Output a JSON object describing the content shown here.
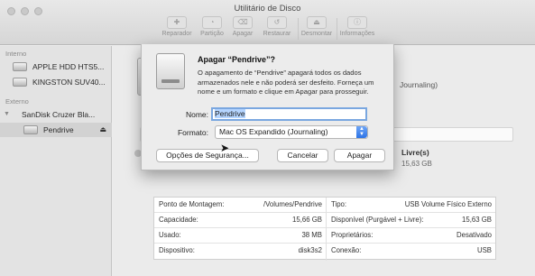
{
  "window": {
    "title": "Utilitário de Disco"
  },
  "toolbar": {
    "items": [
      {
        "label": "Reparador",
        "icon": "stethoscope-icon",
        "glyph": "✚"
      },
      {
        "label": "Partição",
        "icon": "pie-icon",
        "glyph": "◔"
      },
      {
        "label": "Apagar",
        "icon": "erase-icon",
        "glyph": "⌫"
      },
      {
        "label": "Restaurar",
        "icon": "restore-icon",
        "glyph": "↺"
      },
      {
        "label": "Desmontar",
        "icon": "unmount-icon",
        "glyph": "⏏"
      },
      {
        "label": "Informações",
        "icon": "info-icon",
        "glyph": "ⓘ"
      }
    ]
  },
  "sidebar": {
    "sections": {
      "internal": "Interno",
      "external": "Externo"
    },
    "items": [
      {
        "label": "APPLE HDD HTS5..."
      },
      {
        "label": "KINGSTON SUV40..."
      },
      {
        "label": "SanDisk Cruzer Bla..."
      },
      {
        "label": "Pendrive",
        "eject": "⏏"
      }
    ]
  },
  "background": {
    "fs_text": "Journaling)",
    "free_label": "Livre(s)",
    "free_value": "15,63 GB"
  },
  "dialog": {
    "title": "Apagar “Pendrive”?",
    "message": "O apagamento de “Pendrive” apagará todos os dados armazenados nele e não poderá ser desfeito. Forneça um nome e um formato e clique em Apagar para prosseguir.",
    "name_label": "Nome:",
    "name_value": "Pendrive",
    "format_label": "Formato:",
    "format_value": "Mac OS Expandido (Journaling)",
    "security_button": "Opções de Segurança...",
    "cancel_button": "Cancelar",
    "erase_button": "Apagar"
  },
  "info_table": {
    "rows": [
      {
        "k1": "Ponto de Montagem:",
        "v1": "/Volumes/Pendrive",
        "k2": "Tipo:",
        "v2": "USB Volume Físico Externo"
      },
      {
        "k1": "Capacidade:",
        "v1": "15,66 GB",
        "k2": "Disponível (Purgável + Livre):",
        "v2": "15,63 GB"
      },
      {
        "k1": "Usado:",
        "v1": "38 MB",
        "k2": "Proprietários:",
        "v2": "Desativado"
      },
      {
        "k1": "Dispositivo:",
        "v1": "disk3s2",
        "k2": "Conexão:",
        "v2": "USB"
      }
    ]
  }
}
